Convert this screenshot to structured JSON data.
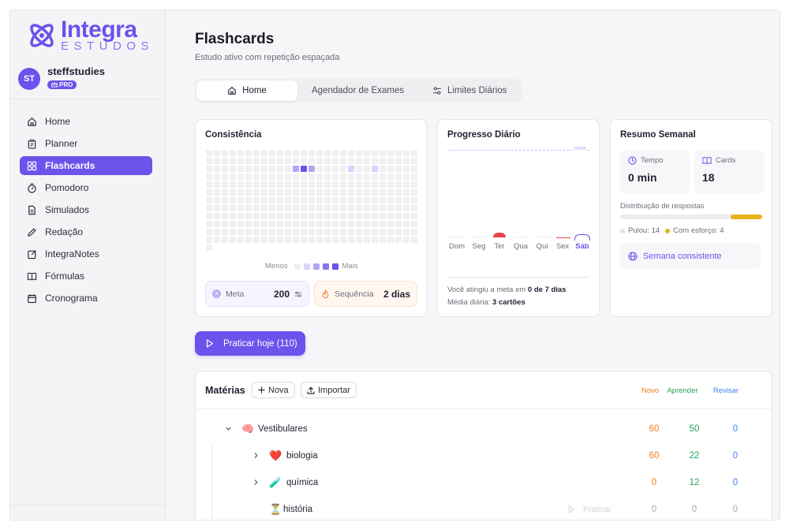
{
  "brand": {
    "name": "Integra",
    "tagline": "ESTUDOS",
    "color": "#6d52ec"
  },
  "user": {
    "initials": "ST",
    "name": "steffstudies",
    "badge": "PRO"
  },
  "nav": [
    {
      "label": "Home",
      "icon": "home-icon"
    },
    {
      "label": "Planner",
      "icon": "clipboard-icon"
    },
    {
      "label": "Flashcards",
      "icon": "grid-icon",
      "active": true
    },
    {
      "label": "Pomodoro",
      "icon": "timer-icon"
    },
    {
      "label": "Simulados",
      "icon": "document-icon"
    },
    {
      "label": "Redação",
      "icon": "pencil-icon"
    },
    {
      "label": "IntegraNotes",
      "icon": "note-icon"
    },
    {
      "label": "Fórmulas",
      "icon": "book-icon"
    },
    {
      "label": "Cronograma",
      "icon": "calendar-icon"
    }
  ],
  "page": {
    "title": "Flashcards",
    "subtitle": "Estudo ativo com repetição espaçada"
  },
  "tabs": [
    {
      "label": "Home",
      "icon": "home-icon",
      "active": true
    },
    {
      "label": "Agendador de Exames"
    },
    {
      "label": "Limites Diários",
      "icon": "sliders-icon"
    }
  ],
  "consistency": {
    "title": "Consistência",
    "legend_less": "Menos",
    "legend_more": "Mais",
    "meta_label": "Meta",
    "meta_value": "200",
    "streak_label": "Sequência",
    "streak_value": "2 dias"
  },
  "daily": {
    "title": "Progresso Diário",
    "goal_label": "meta",
    "days": [
      "Dom",
      "Seg",
      "Ter",
      "Qua",
      "Qui",
      "Sex",
      "Sáb"
    ],
    "today": "Sáb",
    "summary_prefix": "Você atingiu a meta em ",
    "summary_value": "0 de 7 dias",
    "avg_prefix": "Média diária: ",
    "avg_value": "3 cartões"
  },
  "weekly": {
    "title": "Resumo Semanal",
    "time_label": "Tempo",
    "time_value": "0 min",
    "cards_label": "Cards",
    "cards_value": "18",
    "dist_label": "Distribuição de respostas",
    "skipped": "Pulou: 14",
    "effort": "Com esforço: 4",
    "consistent": "Semana consistente"
  },
  "practice": {
    "label": "Praticar hoje (110)"
  },
  "subjects": {
    "title": "Matérias",
    "new_label": "Nova",
    "import_label": "Importar",
    "col_new": "Novo",
    "col_learn": "Aprender",
    "col_review": "Revisar",
    "ghost_practice": "Praticar",
    "rows": [
      {
        "name": "Vestibulares",
        "emoji": "🧠",
        "new": "60",
        "learn": "50",
        "review": "0",
        "level": 0,
        "expanded": true
      },
      {
        "name": "biologia",
        "emoji": "❤️",
        "new": "60",
        "learn": "22",
        "review": "0",
        "level": 1
      },
      {
        "name": "química",
        "emoji": "🧪",
        "new": "0",
        "learn": "12",
        "review": "0",
        "level": 1
      },
      {
        "name": "história",
        "emoji": "⏳",
        "new": "0",
        "learn": "0",
        "review": "0",
        "level": 1
      }
    ]
  }
}
